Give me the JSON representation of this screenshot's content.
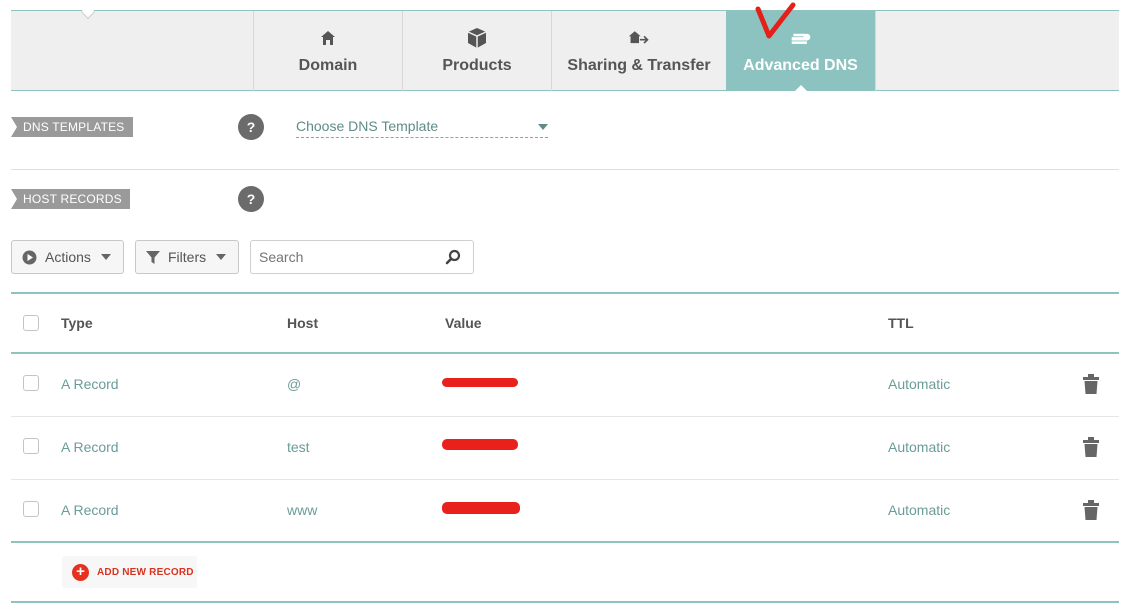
{
  "tabs": [
    {
      "label": "Domain",
      "icon": "home-icon"
    },
    {
      "label": "Products",
      "icon": "box-icon"
    },
    {
      "label": "Sharing & Transfer",
      "icon": "share-transfer-icon"
    },
    {
      "label": "Advanced DNS",
      "icon": "dns-icon",
      "active": true
    }
  ],
  "sections": {
    "dns_templates": "DNS TEMPLATES",
    "host_records": "HOST RECORDS",
    "help": "?"
  },
  "dns_template_select": {
    "value": "Choose DNS Template"
  },
  "toolbar": {
    "actions_label": "Actions",
    "filters_label": "Filters",
    "search_placeholder": "Search"
  },
  "table": {
    "columns": [
      "Type",
      "Host",
      "Value",
      "TTL"
    ],
    "rows": [
      {
        "type": "A Record",
        "host": "@",
        "value": "",
        "ttl": "Automatic"
      },
      {
        "type": "A Record",
        "host": "test",
        "value": "",
        "ttl": "Automatic"
      },
      {
        "type": "A Record",
        "host": "www",
        "value": "",
        "ttl": "Automatic"
      }
    ]
  },
  "add_record_label": "ADD NEW RECORD",
  "colors": {
    "accent": "#8cc3c0",
    "link": "#6a9c99",
    "danger": "#e8301f",
    "redaction": "#e8211d"
  }
}
